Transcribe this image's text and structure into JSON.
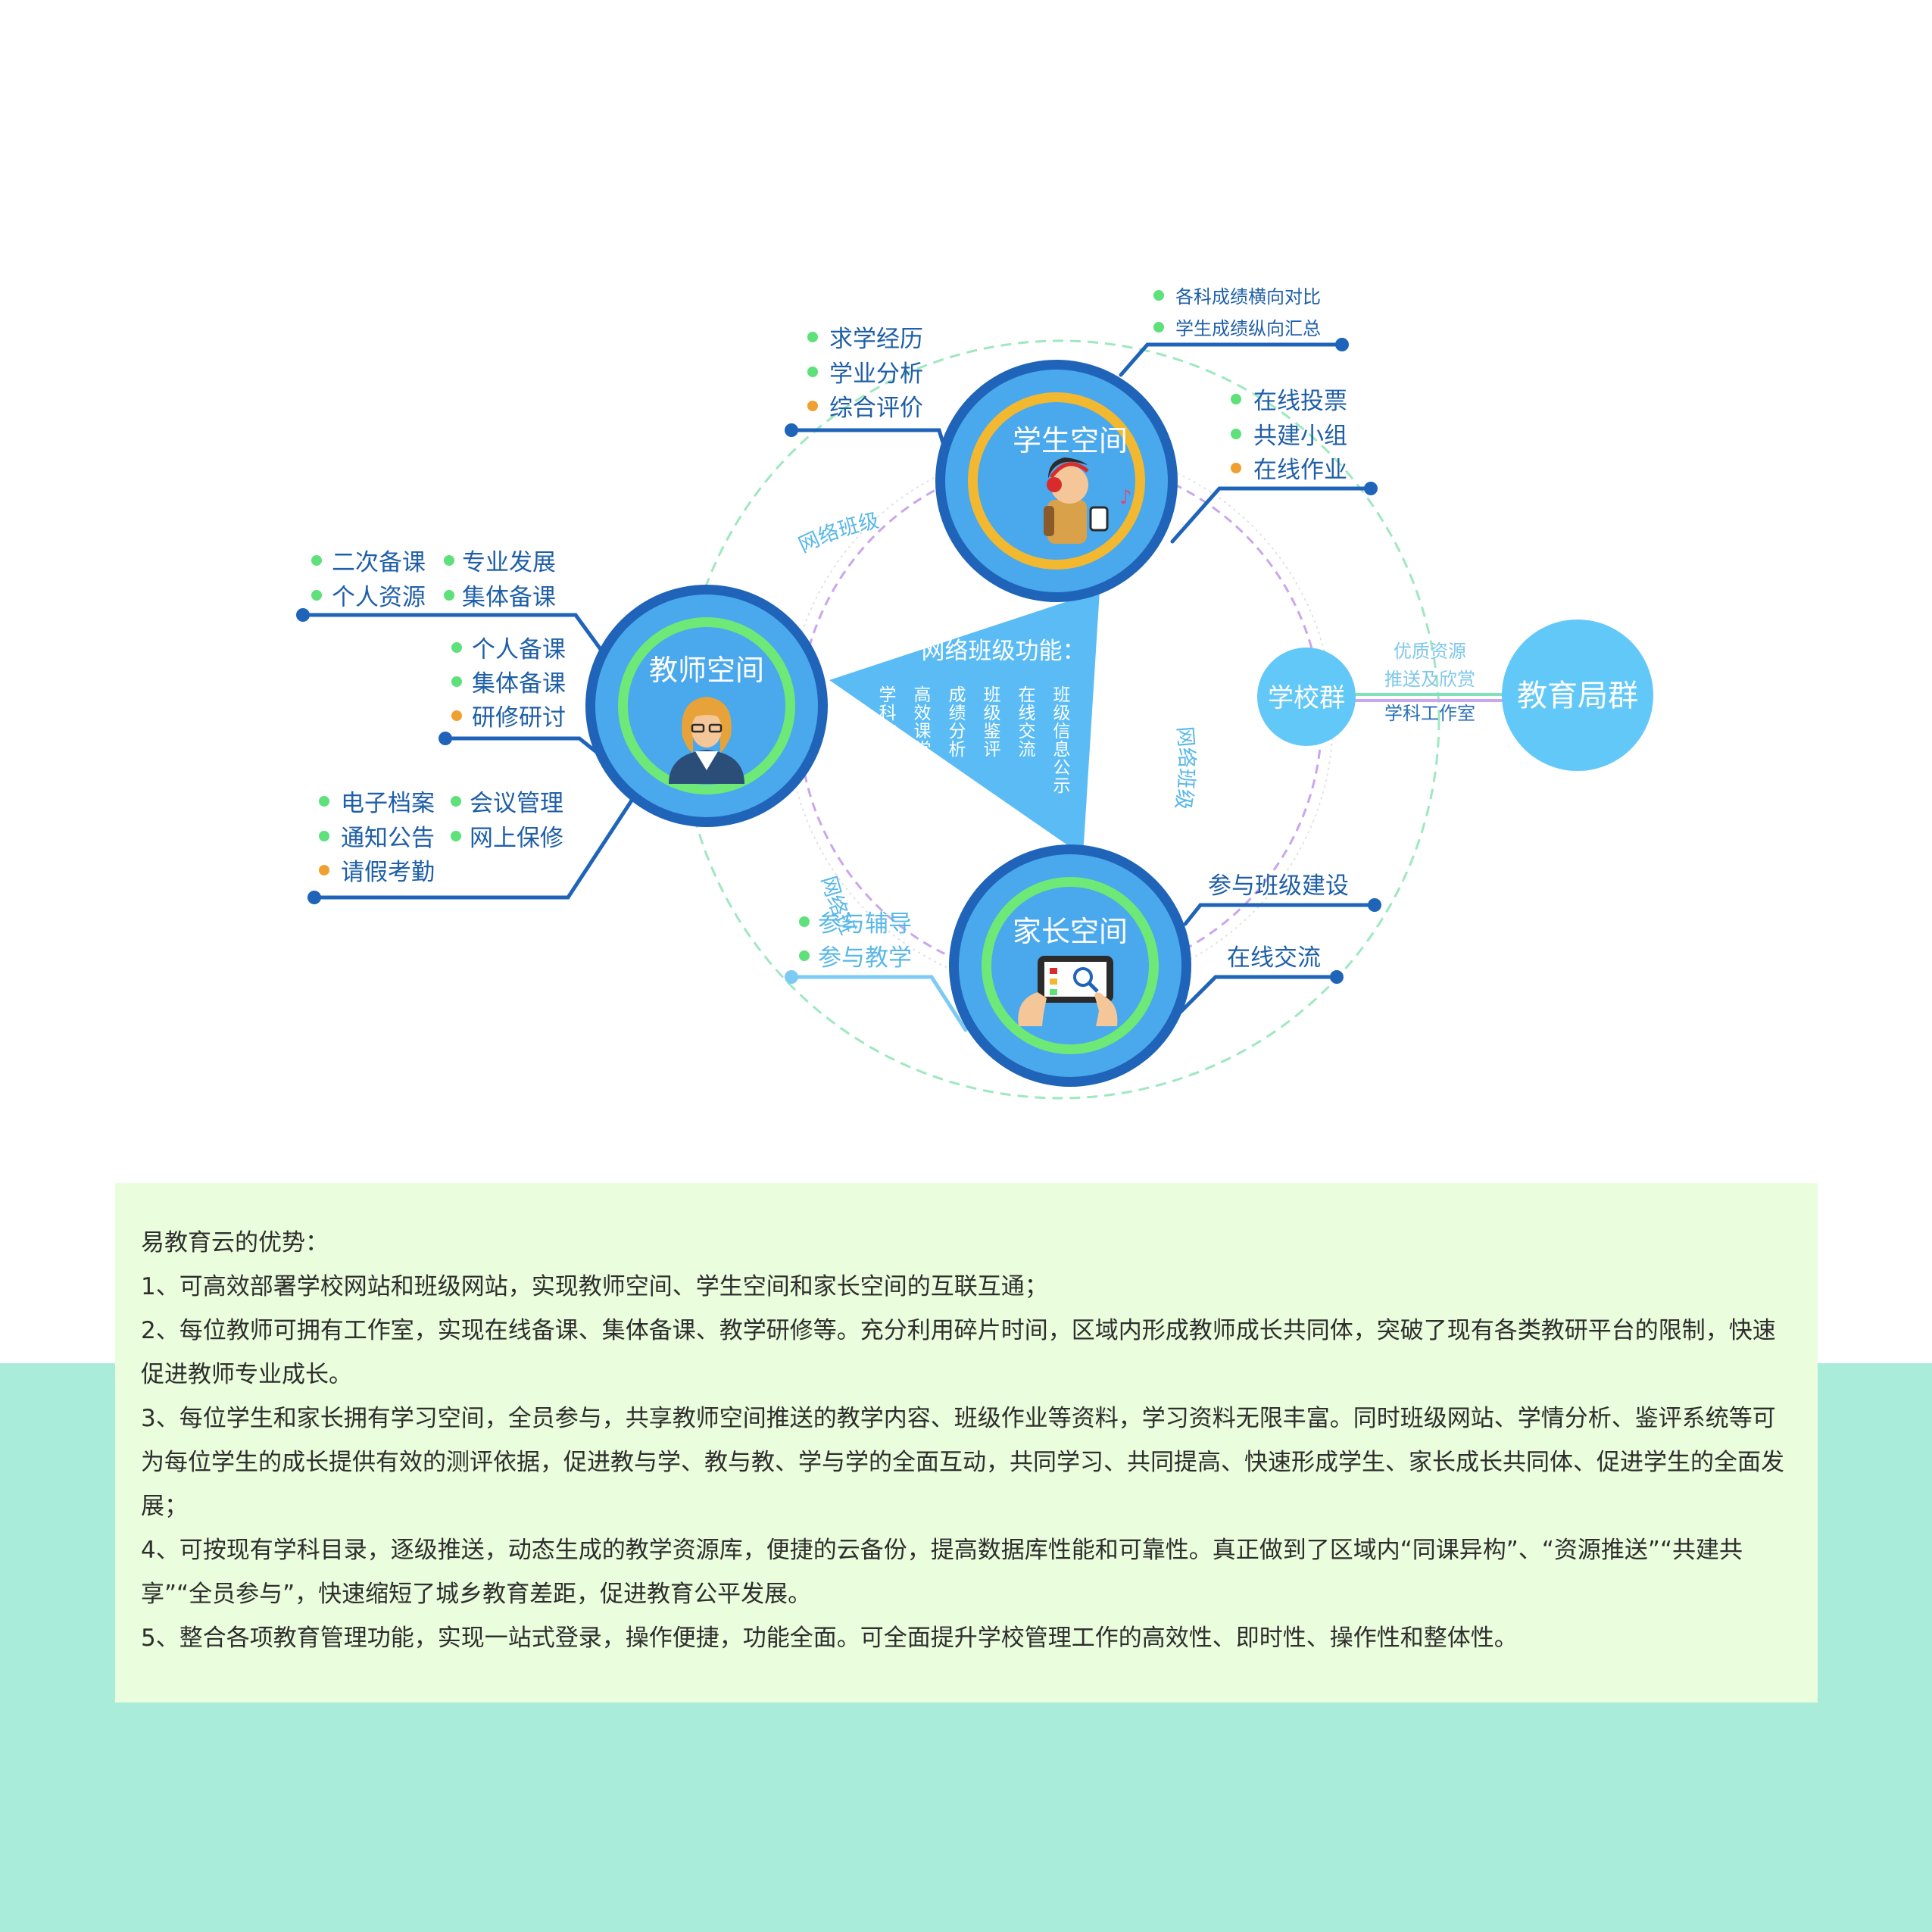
{
  "diagram": {
    "center": {
      "title": "网络班级功能：",
      "columns": [
        "学科作业",
        "高效课堂",
        "成绩分析",
        "班级鉴评",
        "在线交流",
        "班级信息公示"
      ]
    },
    "ring_labels": [
      "网络班级",
      "网络班级",
      "网络班级"
    ],
    "student": {
      "title": "学生空间",
      "top_items": [
        "各科成绩横向对比",
        "学生成绩纵向汇总"
      ],
      "left_items": [
        "求学经历",
        "学业分析",
        "综合评价"
      ],
      "right_items": [
        "在线投票",
        "共建小组",
        "在线作业"
      ]
    },
    "teacher": {
      "title": "教师空间",
      "group1": [
        "二次备课",
        "专业发展",
        "个人资源",
        "集体备课"
      ],
      "group2": [
        "个人备课",
        "集体备课",
        "研修研讨"
      ],
      "group3": [
        "电子档案",
        "会议管理",
        "通知公告",
        "网上保修",
        "请假考勤"
      ]
    },
    "parent": {
      "title": "家长空间",
      "left_items": [
        "参与辅导",
        "参与教学"
      ],
      "right_items": [
        "参与班级建设",
        "在线交流"
      ]
    },
    "school_group": "学校群",
    "bureau_group": "教育局群",
    "links": [
      "优质资源",
      "推送及欣赏",
      "学科工作室"
    ],
    "colors": {
      "dark_blue": "#1f64b8",
      "sky_blue": "#4aa8ec",
      "light_blue": "#62c8f8",
      "green_bullet": "#5ee07a",
      "orange_bullet": "#f0a030",
      "yellow_ring": "#f2b830",
      "green_ring": "#6ee877"
    }
  },
  "panel": {
    "heading": "易教育云的优势：",
    "items": [
      "1、可高效部署学校网站和班级网站，实现教师空间、学生空间和家长空间的互联互通；",
      "2、每位教师可拥有工作室，实现在线备课、集体备课、教学研修等。充分利用碎片时间，区域内形成教师成长共同体，突破了现有各类教研平台的限制，快速促进教师专业成长。",
      "3、每位学生和家长拥有学习空间，全员参与，共享教师空间推送的教学内容、班级作业等资料，学习资料无限丰富。同时班级网站、学情分析、鉴评系统等可为每位学生的成长提供有效的测评依据，促进教与学、教与教、学与学的全面互动，共同学习、共同提高、快速形成学生、家长成长共同体、促进学生的全面发展；",
      "4、可按现有学科目录，逐级推送，动态生成的教学资源库，便捷的云备份，提高数据库性能和可靠性。真正做到了区域内“同课异构”、“资源推送”“共建共享”“全员参与”，快速缩短了城乡教育差距，促进教育公平发展。",
      "5、整合各项教育管理功能，实现一站式登录，操作便捷，功能全面。可全面提升学校管理工作的高效性、即时性、操作性和整体性。"
    ]
  }
}
